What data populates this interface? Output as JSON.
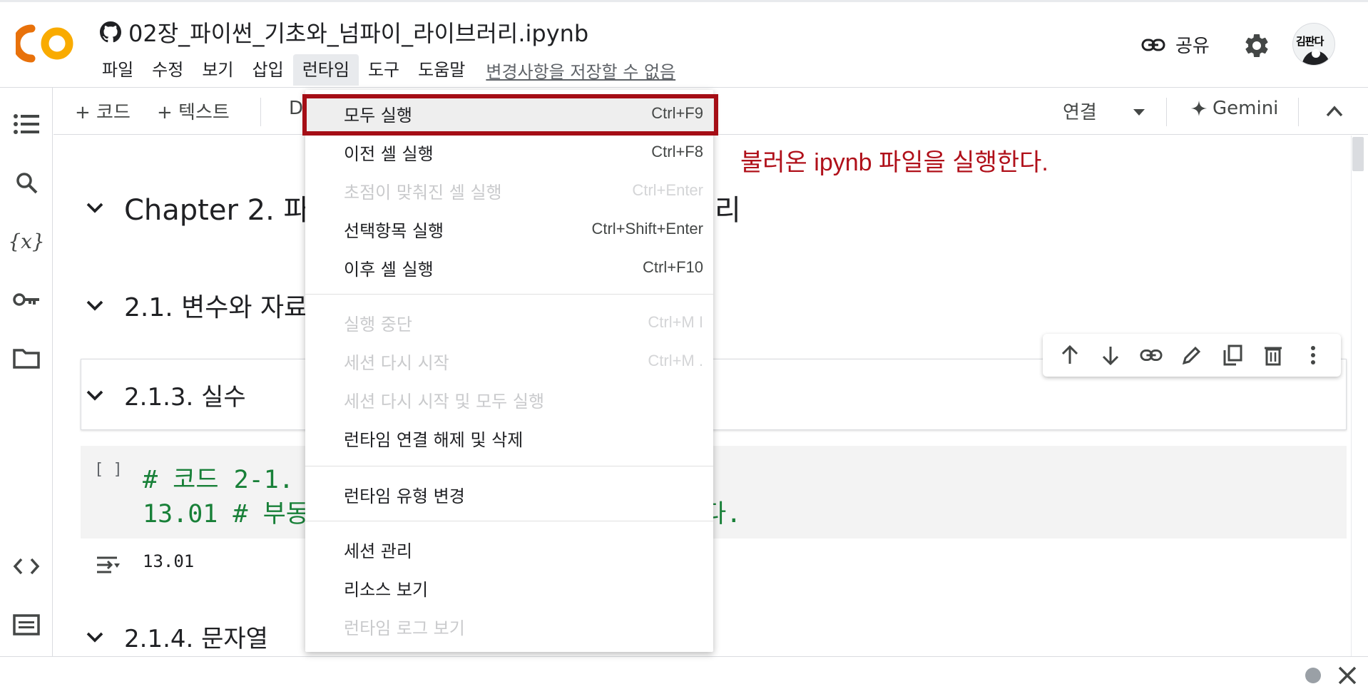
{
  "colors": {
    "accent_orange": "#f9ab00",
    "highlight_red": "#a50e16",
    "annotation_red": "#b0101a",
    "code_green": "#188038"
  },
  "header": {
    "notebook_title": "02장_파이썬_기초와_넘파이_라이브러리.ipynb",
    "title_icon": "github-icon",
    "logo": "CO",
    "menu": [
      "파일",
      "수정",
      "보기",
      "삽입",
      "런타임",
      "도구",
      "도움말"
    ],
    "active_menu": "런타임",
    "unsaved_notice": "변경사항을 저장할 수 없음",
    "share_label": "공유",
    "avatar_text": "김판다"
  },
  "toolbar": {
    "add_code": "+ 코드",
    "add_text": "+ 텍스트",
    "truncated_button": "D",
    "connect_label": "연결",
    "gemini_label": "Gemini"
  },
  "sidebar_icons": [
    "toc-icon",
    "search-icon",
    "variables-icon",
    "key-icon",
    "folder-icon",
    "code-snippets-icon",
    "terminal-icon"
  ],
  "notebook": {
    "h1": "Chapter 2. 파",
    "h1_tail": "리",
    "h2": "2.1. 변수와 자료",
    "h3": "2.1.3. 실수",
    "code_bracket": "[ ]",
    "code_line1": "# 코드 2-1.",
    "code_line2": "13.01 # 부동",
    "code_line2_tail": "다.",
    "output": "13.01",
    "h4": "2.1.4. 문자열"
  },
  "runtime_menu": {
    "items": [
      {
        "label": "모두 실행",
        "shortcut": "Ctrl+F9",
        "enabled": true,
        "highlighted": true
      },
      {
        "label": "이전 셀 실행",
        "shortcut": "Ctrl+F8",
        "enabled": true
      },
      {
        "label": "초점이 맞춰진 셀 실행",
        "shortcut": "Ctrl+Enter",
        "enabled": false
      },
      {
        "label": "선택항목 실행",
        "shortcut": "Ctrl+Shift+Enter",
        "enabled": true
      },
      {
        "label": "이후 셀 실행",
        "shortcut": "Ctrl+F10",
        "enabled": true
      },
      {
        "label": "실행 중단",
        "shortcut": "Ctrl+M I",
        "enabled": false
      },
      {
        "label": "세션 다시 시작",
        "shortcut": "Ctrl+M .",
        "enabled": false
      },
      {
        "label": "세션 다시 시작 및 모두 실행",
        "shortcut": "",
        "enabled": false
      },
      {
        "label": "런타임 연결 해제 및 삭제",
        "shortcut": "",
        "enabled": true
      },
      {
        "label": "런타임 유형 변경",
        "shortcut": "",
        "enabled": true
      },
      {
        "label": "세션 관리",
        "shortcut": "",
        "enabled": true
      },
      {
        "label": "리소스 보기",
        "shortcut": "",
        "enabled": true
      },
      {
        "label": "런타임 로그 보기",
        "shortcut": "",
        "enabled": false
      }
    ]
  },
  "annotation": "불러온 ipynb 파일을 실행한다.",
  "cell_toolbar_icons": [
    "move-up-icon",
    "move-down-icon",
    "link-icon",
    "edit-icon",
    "mirror-cell-icon",
    "delete-icon",
    "more-vert-icon"
  ]
}
